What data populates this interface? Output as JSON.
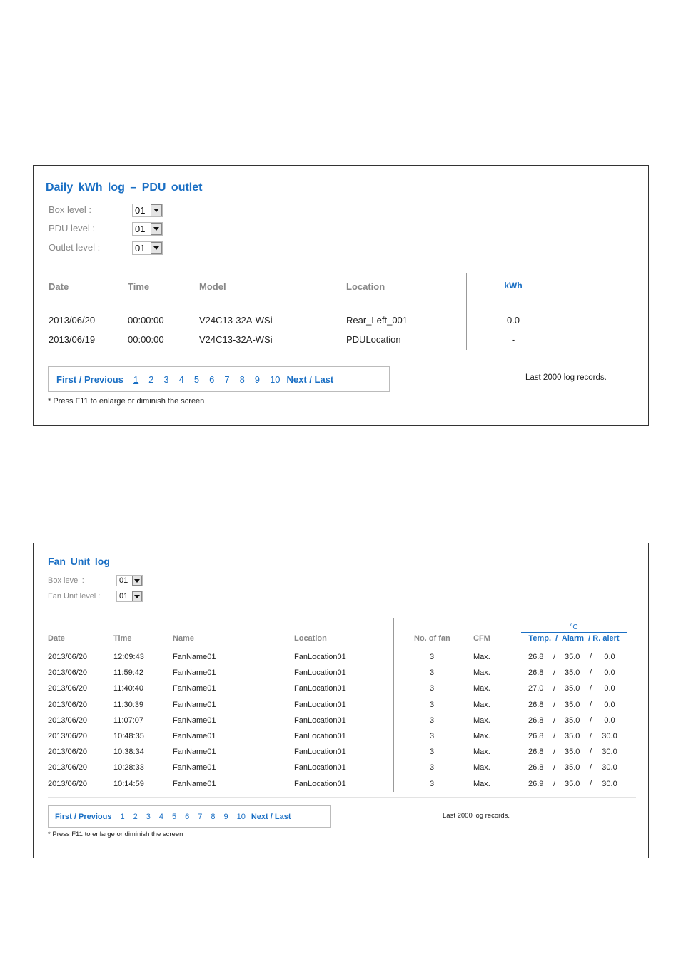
{
  "kwh_log": {
    "title": "Daily  kWh  log  –  PDU  outlet",
    "levels": [
      {
        "label": "Box level :",
        "value": "01"
      },
      {
        "label": "PDU level :",
        "value": "01"
      },
      {
        "label": "Outlet level :",
        "value": "01"
      }
    ],
    "columns": {
      "date": "Date",
      "time": "Time",
      "model": "Model",
      "location": "Location",
      "kwh": "kWh"
    },
    "rows": [
      {
        "date": "2013/06/20",
        "time": "00:00:00",
        "model": "V24C13-32A-WSi",
        "location": "Rear_Left_001",
        "kwh": "0.0"
      },
      {
        "date": "2013/06/19",
        "time": "00:00:00",
        "model": "V24C13-32A-WSi",
        "location": "PDULocation",
        "kwh": "-"
      }
    ],
    "pager": {
      "first_prev": "First / Previous",
      "pages": [
        "1",
        "2",
        "3",
        "4",
        "5",
        "6",
        "7",
        "8",
        "9",
        "10"
      ],
      "current": "1",
      "next_last": "Next / Last"
    },
    "note": "* Press F11 to enlarge or diminish the screen",
    "records": "Last 2000 log records."
  },
  "fan_log": {
    "title": "Fan  Unit  log",
    "levels": [
      {
        "label": "Box level :",
        "value": "01"
      },
      {
        "label": "Fan Unit level :",
        "value": "01"
      }
    ],
    "columns": {
      "date": "Date",
      "time": "Time",
      "name": "Name",
      "location": "Location",
      "fans": "No. of fan",
      "cfm": "CFM",
      "unit": "°C",
      "temp_group": "Temp.  /  Alarm  / R. alert"
    },
    "rows": [
      {
        "date": "2013/06/20",
        "time": "12:09:43",
        "name": "FanName01",
        "location": "FanLocation01",
        "fans": "3",
        "cfm": "Max.",
        "temp": "26.8",
        "alarm": "35.0",
        "ralert": "0.0"
      },
      {
        "date": "2013/06/20",
        "time": "11:59:42",
        "name": "FanName01",
        "location": "FanLocation01",
        "fans": "3",
        "cfm": "Max.",
        "temp": "26.8",
        "alarm": "35.0",
        "ralert": "0.0"
      },
      {
        "date": "2013/06/20",
        "time": "11:40:40",
        "name": "FanName01",
        "location": "FanLocation01",
        "fans": "3",
        "cfm": "Max.",
        "temp": "27.0",
        "alarm": "35.0",
        "ralert": "0.0"
      },
      {
        "date": "2013/06/20",
        "time": "11:30:39",
        "name": "FanName01",
        "location": "FanLocation01",
        "fans": "3",
        "cfm": "Max.",
        "temp": "26.8",
        "alarm": "35.0",
        "ralert": "0.0"
      },
      {
        "date": "2013/06/20",
        "time": "11:07:07",
        "name": "FanName01",
        "location": "FanLocation01",
        "fans": "3",
        "cfm": "Max.",
        "temp": "26.8",
        "alarm": "35.0",
        "ralert": "0.0"
      },
      {
        "date": "2013/06/20",
        "time": "10:48:35",
        "name": "FanName01",
        "location": "FanLocation01",
        "fans": "3",
        "cfm": "Max.",
        "temp": "26.8",
        "alarm": "35.0",
        "ralert": "30.0"
      },
      {
        "date": "2013/06/20",
        "time": "10:38:34",
        "name": "FanName01",
        "location": "FanLocation01",
        "fans": "3",
        "cfm": "Max.",
        "temp": "26.8",
        "alarm": "35.0",
        "ralert": "30.0"
      },
      {
        "date": "2013/06/20",
        "time": "10:28:33",
        "name": "FanName01",
        "location": "FanLocation01",
        "fans": "3",
        "cfm": "Max.",
        "temp": "26.8",
        "alarm": "35.0",
        "ralert": "30.0"
      },
      {
        "date": "2013/06/20",
        "time": "10:14:59",
        "name": "FanName01",
        "location": "FanLocation01",
        "fans": "3",
        "cfm": "Max.",
        "temp": "26.9",
        "alarm": "35.0",
        "ralert": "30.0"
      }
    ],
    "separator": "/",
    "pager": {
      "first_prev": "First / Previous",
      "pages": [
        "1",
        "2",
        "3",
        "4",
        "5",
        "6",
        "7",
        "8",
        "9",
        "10"
      ],
      "current": "1",
      "next_last": "Next / Last"
    },
    "note": "* Press F11 to enlarge or diminish the screen",
    "records": "Last 2000 log records."
  },
  "colors": {
    "accent": "#1a6fc4",
    "label": "#888888",
    "text": "#222222"
  }
}
